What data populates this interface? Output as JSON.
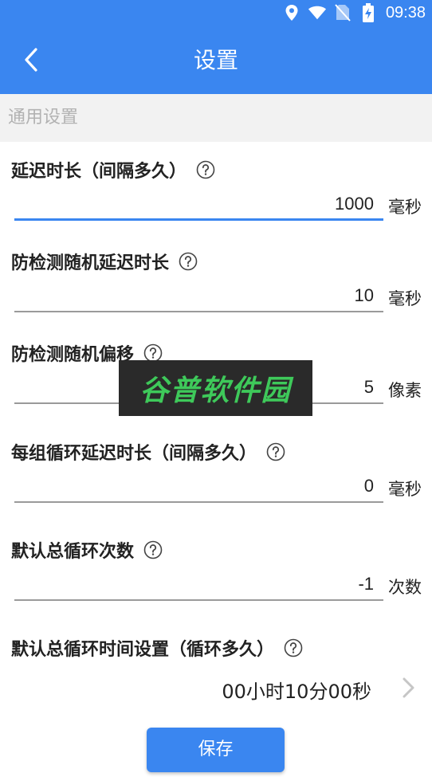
{
  "status_bar": {
    "time": "09:38",
    "icons": [
      "location-icon",
      "wifi-icon",
      "no-sim-icon",
      "battery-charging-icon"
    ]
  },
  "app_bar": {
    "title": "设置",
    "back_icon": "chevron-left-icon"
  },
  "section": {
    "title": "通用设置"
  },
  "settings": [
    {
      "label": "延迟时长（间隔多久）",
      "value": "1000",
      "unit": "毫秒"
    },
    {
      "label": "防检测随机延迟时长",
      "value": "10",
      "unit": "毫秒"
    },
    {
      "label": "防检测随机偏移",
      "value": "5",
      "unit": "像素"
    },
    {
      "label": "每组循环延迟时长（间隔多久）",
      "value": "0",
      "unit": "毫秒"
    },
    {
      "label": "默认总循环次数",
      "value": "-1",
      "unit": "次数"
    }
  ],
  "loop_time": {
    "label": "默认总循环时间设置（循环多久）",
    "value": "00小时10分00秒"
  },
  "save_button": "保存",
  "watermark": "谷普软件园",
  "colors": {
    "primary": "#3a86f0",
    "section_bg": "#f2f2f2",
    "watermark_bg": "#2a2a2a",
    "watermark_text": "#3ec95a"
  }
}
